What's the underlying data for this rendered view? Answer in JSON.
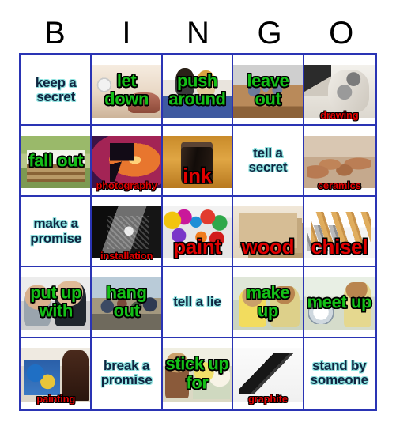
{
  "header": {
    "letters": [
      "B",
      "I",
      "N",
      "G",
      "O"
    ]
  },
  "colors": {
    "grid_border": "#2a34b4",
    "phrase_plain_text": "#10233f",
    "phrase_plain_outline": "#8fe3e0",
    "phrase_green_text": "#14c017",
    "word_red_text": "#e00000",
    "outline_black": "#000000",
    "background": "#ffffff"
  },
  "grid": {
    "rows": 5,
    "columns": 5,
    "cells": [
      [
        {
          "text": "keep a secret",
          "style": "phrase-plain",
          "anchor": "anchor-center",
          "art": "none"
        },
        {
          "text": "let down",
          "style": "phrase-green",
          "anchor": "anchor-center",
          "art": "art-clock"
        },
        {
          "text": "push around",
          "style": "phrase-green",
          "anchor": "anchor-center",
          "art": "art-people-argue"
        },
        {
          "text": "leave out",
          "style": "phrase-green",
          "anchor": "anchor-center",
          "art": "art-gym"
        },
        {
          "text": "drawing",
          "style": "word-red-sm",
          "anchor": "anchor-bottom",
          "art": "art-sketch"
        }
      ],
      [
        {
          "text": "fall out",
          "style": "phrase-green",
          "anchor": "anchor-center",
          "art": "art-park-bench"
        },
        {
          "text": "photography",
          "style": "word-red-sm",
          "anchor": "anchor-bottom",
          "art": "art-photographer"
        },
        {
          "text": "ink",
          "style": "word-red-lg",
          "anchor": "anchor-lower",
          "art": "art-inkbottle"
        },
        {
          "text": "tell a secret",
          "style": "phrase-plain",
          "anchor": "anchor-center",
          "art": "none"
        },
        {
          "text": "ceramics",
          "style": "word-red-sm",
          "anchor": "anchor-bottom",
          "art": "art-pots"
        }
      ],
      [
        {
          "text": "make a promise",
          "style": "phrase-plain",
          "anchor": "anchor-center",
          "art": "none"
        },
        {
          "text": "installation",
          "style": "word-red-sm",
          "anchor": "anchor-bottom",
          "art": "art-installation"
        },
        {
          "text": "paint",
          "style": "word-red-lg",
          "anchor": "anchor-lower",
          "art": "art-paints"
        },
        {
          "text": "wood",
          "style": "word-red-lg",
          "anchor": "anchor-lower",
          "art": "art-wood"
        },
        {
          "text": "chisel",
          "style": "word-red-lg",
          "anchor": "anchor-lower",
          "art": "art-chisels"
        }
      ],
      [
        {
          "text": "put up with",
          "style": "phrase-green",
          "anchor": "anchor-center",
          "art": "art-couple-upset"
        },
        {
          "text": "hang out",
          "style": "phrase-green",
          "anchor": "anchor-center",
          "art": "art-street"
        },
        {
          "text": "tell a lie",
          "style": "phrase-plain",
          "anchor": "anchor-center",
          "art": "none"
        },
        {
          "text": "make up",
          "style": "phrase-green",
          "anchor": "anchor-center",
          "art": "art-cafe"
        },
        {
          "text": "meet up",
          "style": "phrase-green",
          "anchor": "anchor-center",
          "art": "art-cinema"
        }
      ],
      [
        {
          "text": "painting",
          "style": "word-red-sm",
          "anchor": "anchor-bottom",
          "art": "art-painter"
        },
        {
          "text": "break a promise",
          "style": "phrase-plain",
          "anchor": "anchor-center",
          "art": "none"
        },
        {
          "text": "stick up for",
          "style": "phrase-green",
          "anchor": "anchor-center",
          "art": "art-help"
        },
        {
          "text": "graphite",
          "style": "word-red-sm",
          "anchor": "anchor-bottom",
          "art": "art-pencil"
        },
        {
          "text": "stand by someone",
          "style": "phrase-plain",
          "anchor": "anchor-center",
          "art": "none"
        }
      ]
    ]
  }
}
